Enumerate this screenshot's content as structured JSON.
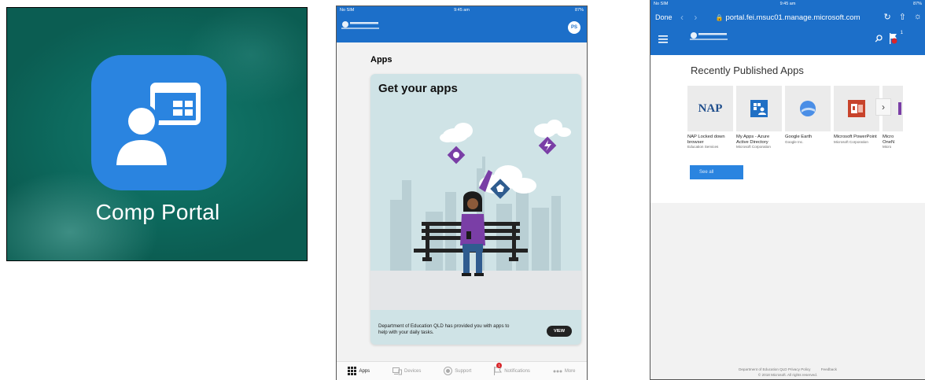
{
  "home_screen": {
    "app_label": "Comp Portal",
    "icon": "company-portal-icon",
    "colors": {
      "icon_bg": "#2a84e0",
      "wallpaper": "#0d6a5e"
    }
  },
  "portal_app": {
    "status_bar": {
      "left": "No SIM",
      "time": "9:45 am",
      "battery": "87%"
    },
    "avatar_initials": "PS",
    "section_title": "Apps",
    "card": {
      "title": "Get your apps",
      "description": "Department of Education QLD has provided you with apps to help with your daily tasks.",
      "view_label": "VIEW"
    },
    "tabs": [
      {
        "label": "Apps",
        "icon": "apps-grid-icon",
        "active": true
      },
      {
        "label": "Devices",
        "icon": "devices-icon",
        "active": false
      },
      {
        "label": "Support",
        "icon": "support-icon",
        "active": false
      },
      {
        "label": "Notifications",
        "icon": "notifications-flag-icon",
        "active": false,
        "badge": "1"
      },
      {
        "label": "More",
        "icon": "more-icon",
        "active": false
      }
    ],
    "colors": {
      "brand": "#1c6fc9",
      "card_bg": "#cfe3e6",
      "accent_purple": "#7a3ea6"
    }
  },
  "web_portal": {
    "status_bar": {
      "left": "No SIM",
      "time": "9:45 am",
      "battery": "87%"
    },
    "done_label": "Done",
    "url": "portal.fei.msuc01.manage.microsoft.com",
    "flag_count": "1",
    "heading": "Recently Published Apps",
    "apps": [
      {
        "name": "NAP Locked down browser",
        "publisher": "Education Services",
        "icon": "nap-text-icon"
      },
      {
        "name": "My Apps - Azure Active Directory",
        "publisher": "Microsoft Corporation",
        "icon": "myapps-azure-icon"
      },
      {
        "name": "Google Earth",
        "publisher": "Google Inc.",
        "icon": "google-earth-icon"
      },
      {
        "name": "Microsoft PowerPoint",
        "publisher": "Microsoft Corporation",
        "icon": "powerpoint-icon"
      },
      {
        "name": "Micro OneN",
        "publisher": "Micro",
        "icon": "onenote-icon"
      }
    ],
    "nap_icon_text": "NAP",
    "see_all_label": "See all",
    "footer": {
      "links": [
        "Department of Education QLD Privacy Policy",
        "Feedback"
      ],
      "copyright": "© 2018 Microsoft. All rights reserved."
    },
    "colors": {
      "brand": "#1c6fc9",
      "button": "#2a84e0"
    }
  }
}
